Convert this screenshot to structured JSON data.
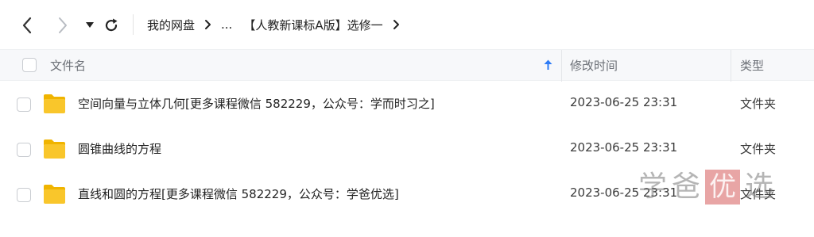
{
  "toolbar": {
    "breadcrumbs": [
      "我的网盘",
      "...",
      "【人教新课标A版】选修一"
    ]
  },
  "table": {
    "columns": [
      "文件名",
      "修改时间",
      "类型"
    ],
    "rows": [
      {
        "name": "空间向量与立体几何[更多课程微信 582229，公众号：学而时习之]",
        "modified": "2023-06-25 23:31",
        "type": "文件夹"
      },
      {
        "name": "圆锥曲线的方程",
        "modified": "2023-06-25 23:31",
        "type": "文件夹"
      },
      {
        "name": "直线和圆的方程[更多课程微信 582229，公众号：学爸优选]",
        "modified": "2023-06-25 23:31",
        "type": "文件夹"
      }
    ]
  },
  "watermark": {
    "chars": [
      "学",
      "爸",
      "优",
      "选"
    ]
  },
  "colors": {
    "folder": "#f9c62b",
    "folder_dark": "#f0b400",
    "accent": "#2e7cf6"
  },
  "icons": [
    "back-arrow-icon",
    "forward-arrow-icon",
    "dropdown-triangle-icon",
    "refresh-icon",
    "chevron-right-icon",
    "sort-up-arrow-icon",
    "folder-icon"
  ]
}
